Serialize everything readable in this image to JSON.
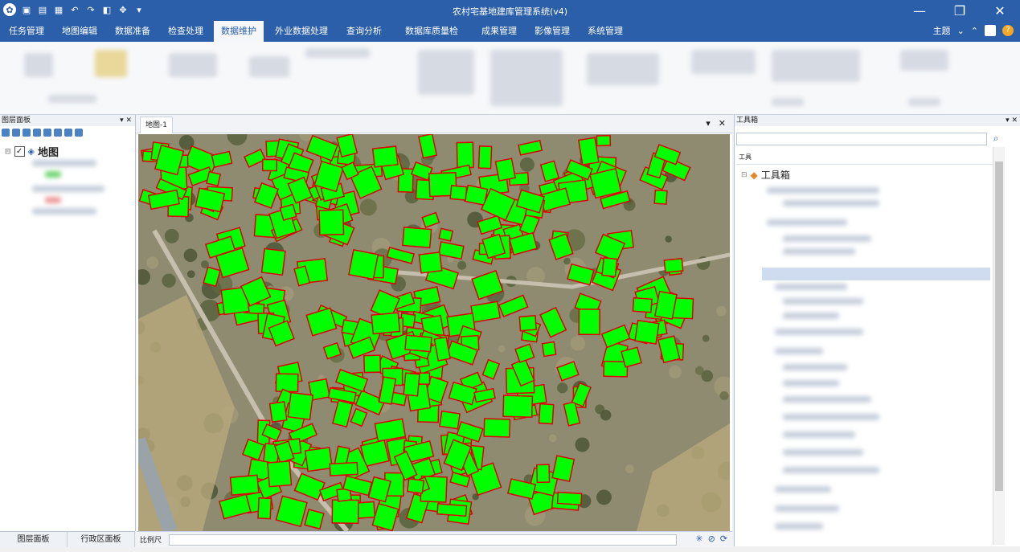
{
  "window": {
    "title": "农村宅基地建库管理系统(v4)",
    "icons": [
      "app-logo-icon",
      "new-icon",
      "open-icon",
      "save-icon",
      "undo-icon",
      "redo-icon",
      "export-icon",
      "move-icon",
      "dropdown-icon"
    ],
    "controls": [
      "minimize-icon",
      "restore-icon",
      "close-icon"
    ]
  },
  "menubar": {
    "tabs": [
      {
        "label": "任务管理",
        "active": false
      },
      {
        "label": "地图编辑",
        "active": false
      },
      {
        "label": "数据准备",
        "active": false
      },
      {
        "label": "检查处理",
        "active": false
      },
      {
        "label": "数据维护",
        "active": true
      },
      {
        "label": "外业数据处理",
        "active": false
      },
      {
        "label": "查询分析",
        "active": false
      },
      {
        "label": "数据库质量检查",
        "active": false
      },
      {
        "label": "成果管理",
        "active": false
      },
      {
        "label": "影像管理",
        "active": false
      },
      {
        "label": "系统管理",
        "active": false
      }
    ],
    "theme_label": "主题"
  },
  "left_panel": {
    "title": "图层面板",
    "root_layer": "地图",
    "root_checked": true,
    "bottom_tabs": [
      "图层面板",
      "行政区面板"
    ]
  },
  "map_doc": {
    "tab_label": "地图-1",
    "scale_label": "比例尺",
    "colors": {
      "building_fill": "#00ff00",
      "building_outline": "#e00000",
      "ground": "#8f8b70"
    }
  },
  "right_panel": {
    "title": "工具箱",
    "section_header": "工具",
    "root_label": "工具箱"
  }
}
